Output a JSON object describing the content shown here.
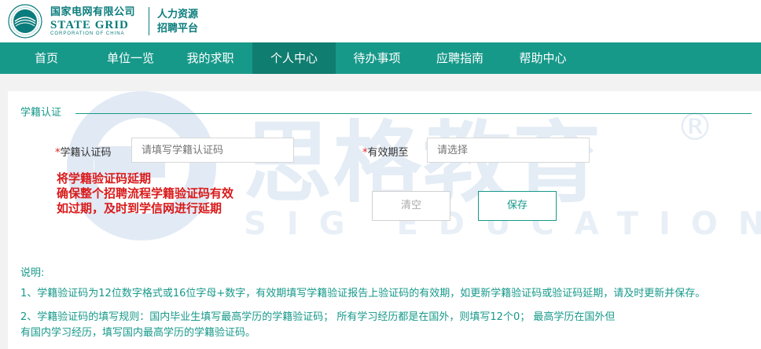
{
  "header": {
    "brand_cn": "国家电网有限公司",
    "brand_en": "STATE GRID",
    "brand_en_sub": "CORPORATION OF CHINA",
    "subsys_line1": "人力资源",
    "subsys_line2": "招聘平台"
  },
  "nav": {
    "items": [
      {
        "label": "首页"
      },
      {
        "label": "单位一览"
      },
      {
        "label": "我的求职"
      },
      {
        "label": "个人中心",
        "active": true
      },
      {
        "label": "待办事项"
      },
      {
        "label": "应聘指南"
      },
      {
        "label": "帮助中心"
      }
    ]
  },
  "section": {
    "legend": "学籍认证"
  },
  "form": {
    "required_mark": "*",
    "code_label": "学籍认证码",
    "code_placeholder": "请填写学籍认证码",
    "expiry_label": "有效期至",
    "expiry_placeholder": "请选择",
    "clear_label": "清空",
    "save_label": "保存"
  },
  "red_note": {
    "line1": "将学籍验证码延期",
    "line2": "确保整个招聘流程学籍验证码有效",
    "line3": "如过期，及时到学信网进行延期"
  },
  "watermark": {
    "cn": "思格教育",
    "en": "SIG EDUCATION",
    "reg": "®"
  },
  "explain": {
    "title": "说明:",
    "item1": "1、学籍验证码为12位数字格式或16位字母+数字，有效期填写学籍验证报告上验证码的有效期，如更新学籍验证码或验证码延期，请及时更新并保存。",
    "item2_line1": "2、学籍验证码的填写规则：国内毕业生填写最高学历的学籍验证码；  所有学习经历都是在国外，则填写12个0；  最高学历在国外但",
    "item2_line2": "有国内学习经历，填写国内最高学历的学籍验证码。"
  },
  "colors": {
    "brand": "#0b7c7c",
    "nav_bg": "#17998a",
    "nav_active": "#0f7d70",
    "accent_text": "#17998a",
    "warning_red": "#d91a1a"
  },
  "icons": {
    "logo": "state-grid-logo-icon"
  }
}
